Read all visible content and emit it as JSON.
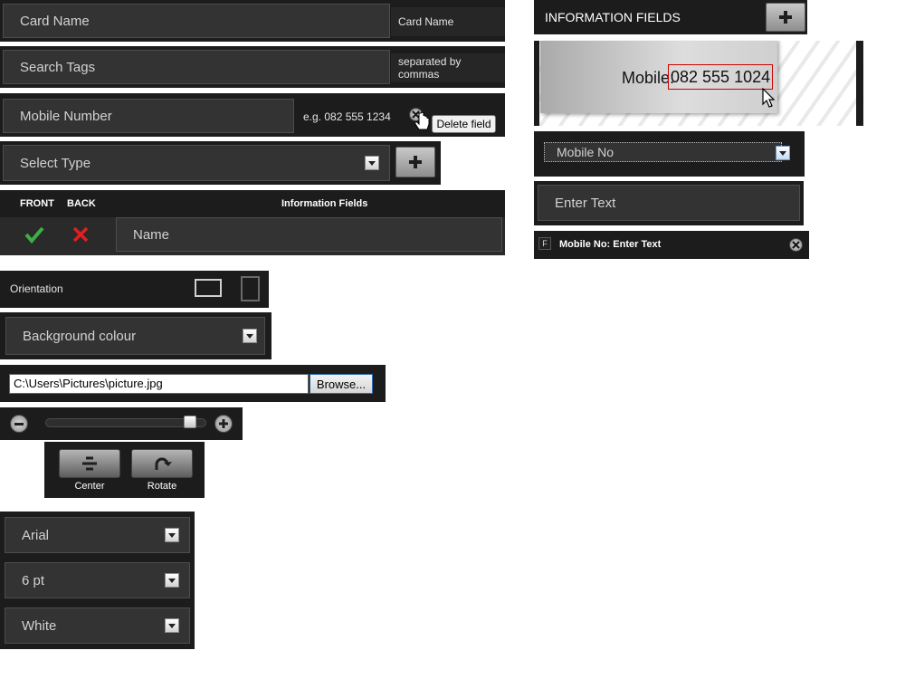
{
  "card_name": {
    "label": "Card Name",
    "hint": "Card Name"
  },
  "search_tags": {
    "label": "Search Tags",
    "hint": "separated by commas"
  },
  "mobile_number": {
    "label": "Mobile Number",
    "hint": "e.g. 082 555 1234",
    "tooltip": "Delete field"
  },
  "select_type": {
    "label": "Select Type"
  },
  "fields_table": {
    "headers": {
      "front": "FRONT",
      "back": "BACK",
      "fields": "Information Fields"
    },
    "rows": [
      {
        "name": "Name"
      }
    ]
  },
  "orientation": {
    "label": "Orientation"
  },
  "background": {
    "label": "Background colour"
  },
  "file": {
    "path": "C:\\Users\\Pictures\\picture.jpg",
    "browse_label": "Browse..."
  },
  "zoom": {
    "level": 0.93
  },
  "image_tools": {
    "center_label": "Center",
    "rotate_label": "Rotate"
  },
  "font": {
    "family": "Arial",
    "size": "6 pt",
    "color": "White"
  },
  "info_panel": {
    "title": "INFORMATION FIELDS",
    "preview_label": "Mobile:",
    "preview_value": "082 555 1024",
    "type_select": "Mobile No",
    "text_input": "Enter Text",
    "summary_badge": "F",
    "summary_text": "Mobile No: Enter Text"
  },
  "colors": {
    "panel": "#1c1c1c",
    "field": "#333333",
    "highlight": "#cc0000",
    "check": "#3cb043",
    "cross": "#e02020"
  }
}
